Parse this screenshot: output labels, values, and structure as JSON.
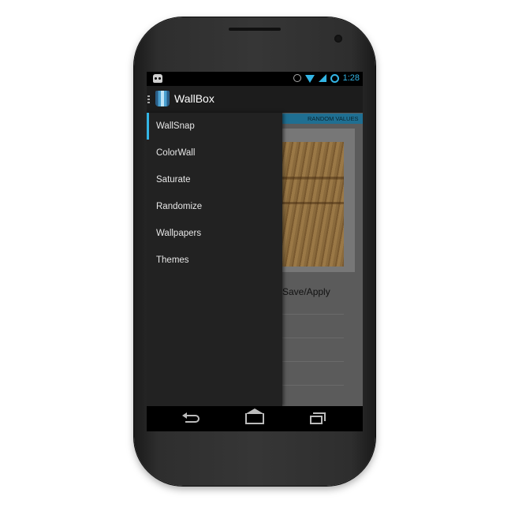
{
  "status_bar": {
    "time": "1:28"
  },
  "action_bar": {
    "title": "WallBox"
  },
  "drawer": {
    "items": [
      {
        "label": "WallSnap",
        "active": true
      },
      {
        "label": "ColorWall",
        "active": false
      },
      {
        "label": "Saturate",
        "active": false
      },
      {
        "label": "Randomize",
        "active": false
      },
      {
        "label": "Wallpapers",
        "active": false
      },
      {
        "label": "Themes",
        "active": false
      }
    ]
  },
  "content": {
    "tab_label": "RANDOM VALUES",
    "save_apply_label": "Save/Apply"
  },
  "colors": {
    "accent": "#33b5e5",
    "drawer_bg": "#222222",
    "content_bg": "#5b5b5b",
    "tab_strip": "#1f6f92"
  },
  "icons": {
    "status_left": "android-icon",
    "status_right": [
      "alarm-icon",
      "wifi-icon",
      "signal-icon",
      "sync-icon"
    ],
    "nav": [
      "back-icon",
      "home-icon",
      "recents-icon"
    ]
  }
}
